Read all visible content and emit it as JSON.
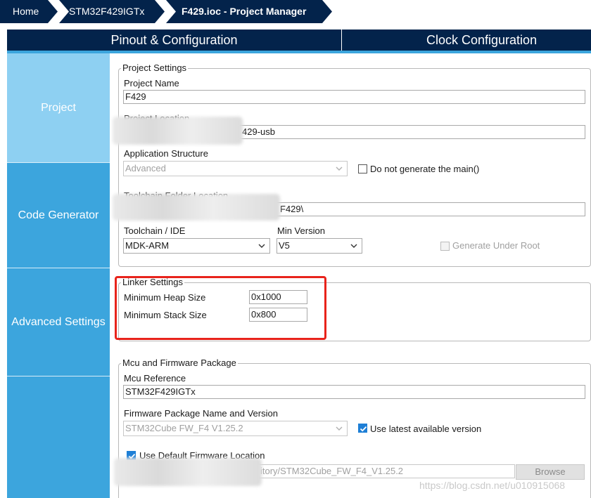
{
  "breadcrumb": {
    "home": "Home",
    "device": "STM32F429IGTx",
    "current": "F429.ioc - Project Manager"
  },
  "tabs": {
    "pinout": "Pinout & Configuration",
    "clock": "Clock Configuration"
  },
  "sidebar": {
    "project": "Project",
    "code_generator": "Code Generator",
    "advanced": "Advanced Settings"
  },
  "project_settings": {
    "legend": "Project Settings",
    "name_label": "Project Name",
    "name_value": "F429",
    "location_label": "Project Location",
    "location_value": "429-usb",
    "app_structure_label": "Application Structure",
    "app_structure_value": "Advanced",
    "no_main_label": "Do not generate the main()",
    "toolchain_folder_label": "Toolchain Folder Location",
    "toolchain_folder_value": "F429\\",
    "toolchain_label": "Toolchain / IDE",
    "toolchain_value": "MDK-ARM",
    "min_version_label": "Min Version",
    "min_version_value": "V5",
    "gen_under_root_label": "Generate Under Root"
  },
  "linker": {
    "legend": "Linker Settings",
    "heap_label": "Minimum Heap Size",
    "heap_value": "0x1000",
    "stack_label": "Minimum Stack Size",
    "stack_value": "0x800"
  },
  "mcu": {
    "legend": "Mcu and Firmware Package",
    "ref_label": "Mcu Reference",
    "ref_value": "STM32F429IGTx",
    "fw_label": "Firmware Package Name and Version",
    "fw_value": "STM32Cube FW_F4 V1.25.2",
    "latest_label": "Use latest available version",
    "default_loc_label": "Use Default Firmware Location",
    "repo_value": "itory/STM32Cube_FW_F4_V1.25.2",
    "browse_label": "Browse"
  },
  "watermark": "https://blog.csdn.net/u010915068",
  "colors": {
    "navy": "#03234b",
    "sidebar": "#3ca5dd",
    "sidebar_selected": "#8ed0f2",
    "highlight": "#e8231b",
    "checkbox": "#1e7fd6"
  }
}
